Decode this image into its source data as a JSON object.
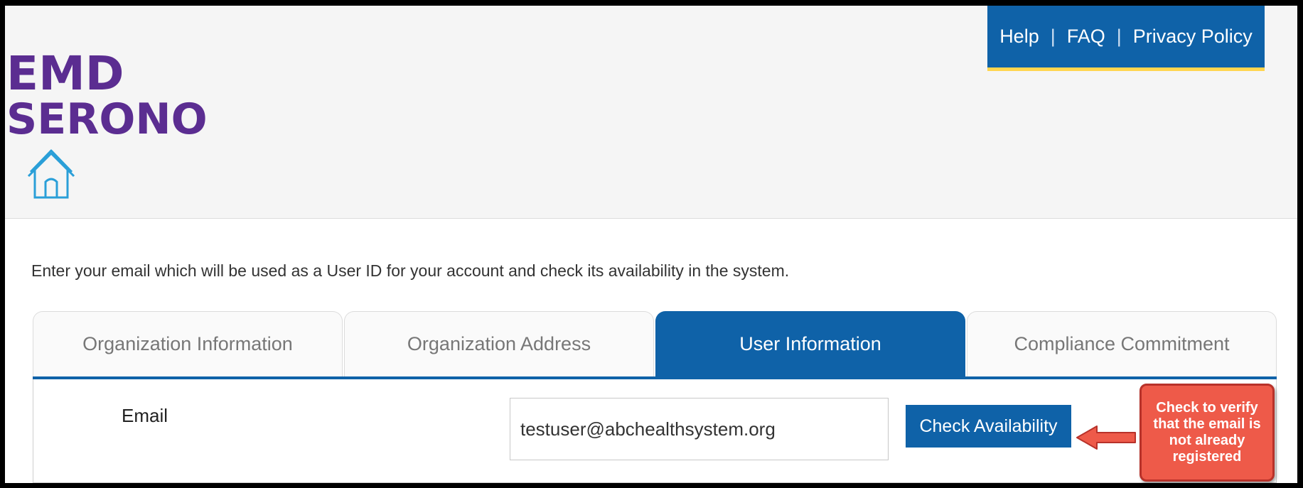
{
  "brand": {
    "logo_line1": "EMD",
    "logo_line2": "SERONO",
    "logo_color": "#5b2d91"
  },
  "utility_nav": {
    "help": "Help",
    "faq": "FAQ",
    "privacy": "Privacy Policy",
    "separator": "|"
  },
  "home_icon": "home-icon",
  "intro_text": "Enter your email which will be used as a User ID for your account and check its availability in the system.",
  "tabs": [
    {
      "label": "Organization Information",
      "active": false
    },
    {
      "label": "Organization Address",
      "active": false
    },
    {
      "label": "User Information",
      "active": true
    },
    {
      "label": "Compliance Commitment",
      "active": false
    }
  ],
  "form": {
    "email_label": "Email",
    "email_value": "testuser@abchealthsystem.org",
    "check_button": "Check Availability"
  },
  "callout": {
    "line1": "Check to verify",
    "line2": "that the email is",
    "line3": "not already",
    "line4": "registered"
  },
  "colors": {
    "primary": "#0f62a8",
    "accent": "#ffd54f",
    "callout": "#ee5a49"
  }
}
